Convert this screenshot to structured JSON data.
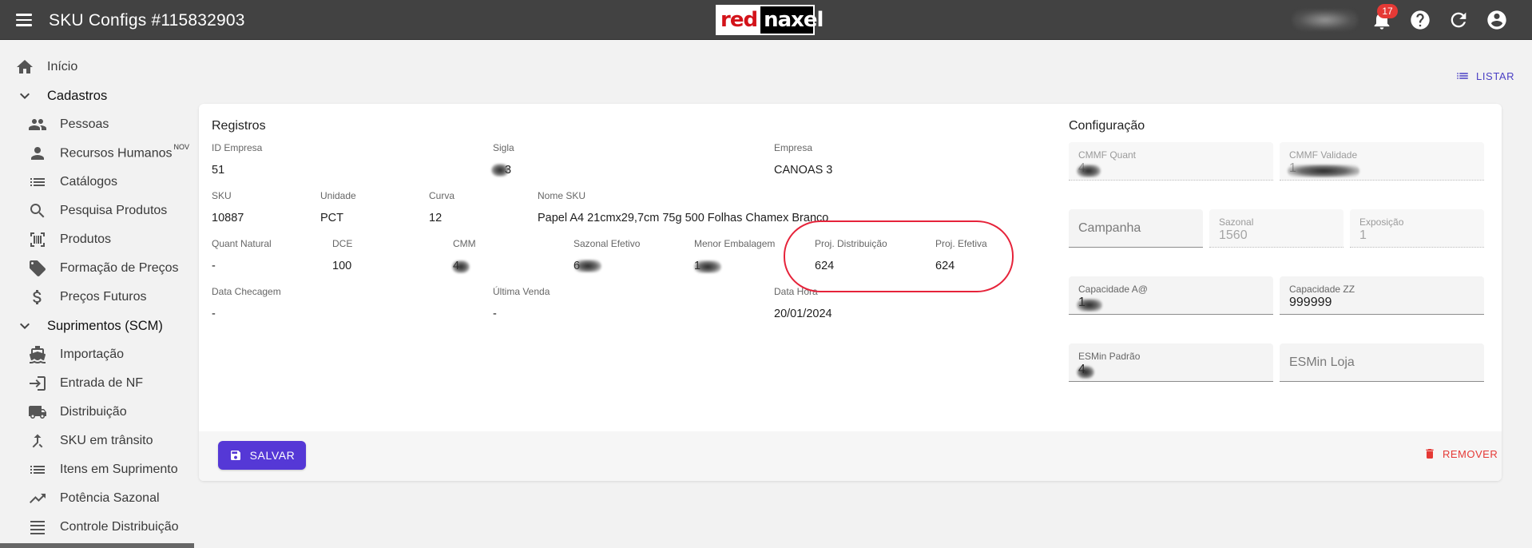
{
  "header": {
    "title": "SKU Configs #115832903",
    "logo_red": "red",
    "logo_rest": "naxel",
    "notifications_count": "17",
    "user_name": "V... (blurred)"
  },
  "sidebar": {
    "items": [
      {
        "label": "Início",
        "icon": "home-icon"
      },
      {
        "label": "Cadastros",
        "icon": "chevron-down-icon"
      },
      {
        "label": "Pessoas",
        "icon": "people-icon"
      },
      {
        "label": "Recursos Humanos",
        "badge": "NOV",
        "icon": "person-icon"
      },
      {
        "label": "Catálogos",
        "icon": "list-icon"
      },
      {
        "label": "Pesquisa Produtos",
        "icon": "search-icon"
      },
      {
        "label": "Produtos",
        "icon": "barcode-icon"
      },
      {
        "label": "Formação de Preços",
        "icon": "tag-icon"
      },
      {
        "label": "Preços Futuros",
        "icon": "dollar-icon"
      },
      {
        "label": "Suprimentos (SCM)",
        "icon": "chevron-down-icon"
      },
      {
        "label": "Importação",
        "icon": "ship-icon"
      },
      {
        "label": "Entrada de NF",
        "icon": "login-icon"
      },
      {
        "label": "Distribuição",
        "icon": "truck-icon"
      },
      {
        "label": "SKU em trânsito",
        "icon": "merge-icon"
      },
      {
        "label": "Itens em Suprimento",
        "icon": "list-icon"
      },
      {
        "label": "Potência Sazonal",
        "icon": "trending-up-icon"
      },
      {
        "label": "Controle Distribuição",
        "icon": "lines-icon"
      }
    ]
  },
  "toolbar": {
    "listar_label": "LISTAR"
  },
  "registros": {
    "title": "Registros",
    "id_empresa_label": "ID Empresa",
    "id_empresa_value": "51",
    "sigla_label": "Sigla",
    "sigla_value": "3",
    "empresa_label": "Empresa",
    "empresa_value": "CANOAS 3",
    "sku_label": "SKU",
    "sku_value": "10887",
    "unidade_label": "Unidade",
    "unidade_value": "PCT",
    "curva_label": "Curva",
    "curva_value": "12",
    "nome_sku_label": "Nome SKU",
    "nome_sku_value": "Papel A4 21cmx29,7cm 75g 500 Folhas Chamex Branco",
    "quant_natural_label": "Quant Natural",
    "quant_natural_value": "-",
    "dce_label": "DCE",
    "dce_value": "100",
    "cmm_label": "CMM",
    "cmm_value": "4",
    "sazonal_efetivo_label": "Sazonal Efetivo",
    "sazonal_efetivo_value": "6",
    "menor_embalagem_label": "Menor Embalagem",
    "menor_embalagem_value": "1",
    "proj_distribuicao_label": "Proj. Distribuição",
    "proj_distribuicao_value": "624",
    "proj_efetiva_label": "Proj. Efetiva",
    "proj_efetiva_value": "624",
    "data_checagem_label": "Data Checagem",
    "data_checagem_value": "-",
    "ultima_venda_label": "Última Venda",
    "ultima_venda_value": "-",
    "data_hora_label": "Data Hora",
    "data_hora_value": "20/01/2024"
  },
  "configuracao": {
    "title": "Configuração",
    "cmmf_quant_label": "CMMF Quant",
    "cmmf_quant_value": "4",
    "cmmf_validade_label": "CMMF Validade",
    "cmmf_validade_value": "1",
    "campanha_placeholder": "Campanha",
    "sazonal_label": "Sazonal",
    "sazonal_value": "1560",
    "exposicao_label": "Exposição",
    "exposicao_value": "1",
    "capacidade_a_label": "Capacidade A@",
    "capacidade_a_value": "1",
    "capacidade_zz_label": "Capacidade ZZ",
    "capacidade_zz_value": "999999",
    "esmin_padrao_label": "ESMin Padrão",
    "esmin_padrao_value": "4",
    "esmin_loja_placeholder": "ESMin Loja"
  },
  "actions": {
    "save_label": "SALVAR",
    "remove_label": "REMOVER"
  },
  "colors": {
    "appbar": "#424242",
    "accent": "#5538d6",
    "danger": "#e53935",
    "highlight": "#e6233a"
  }
}
